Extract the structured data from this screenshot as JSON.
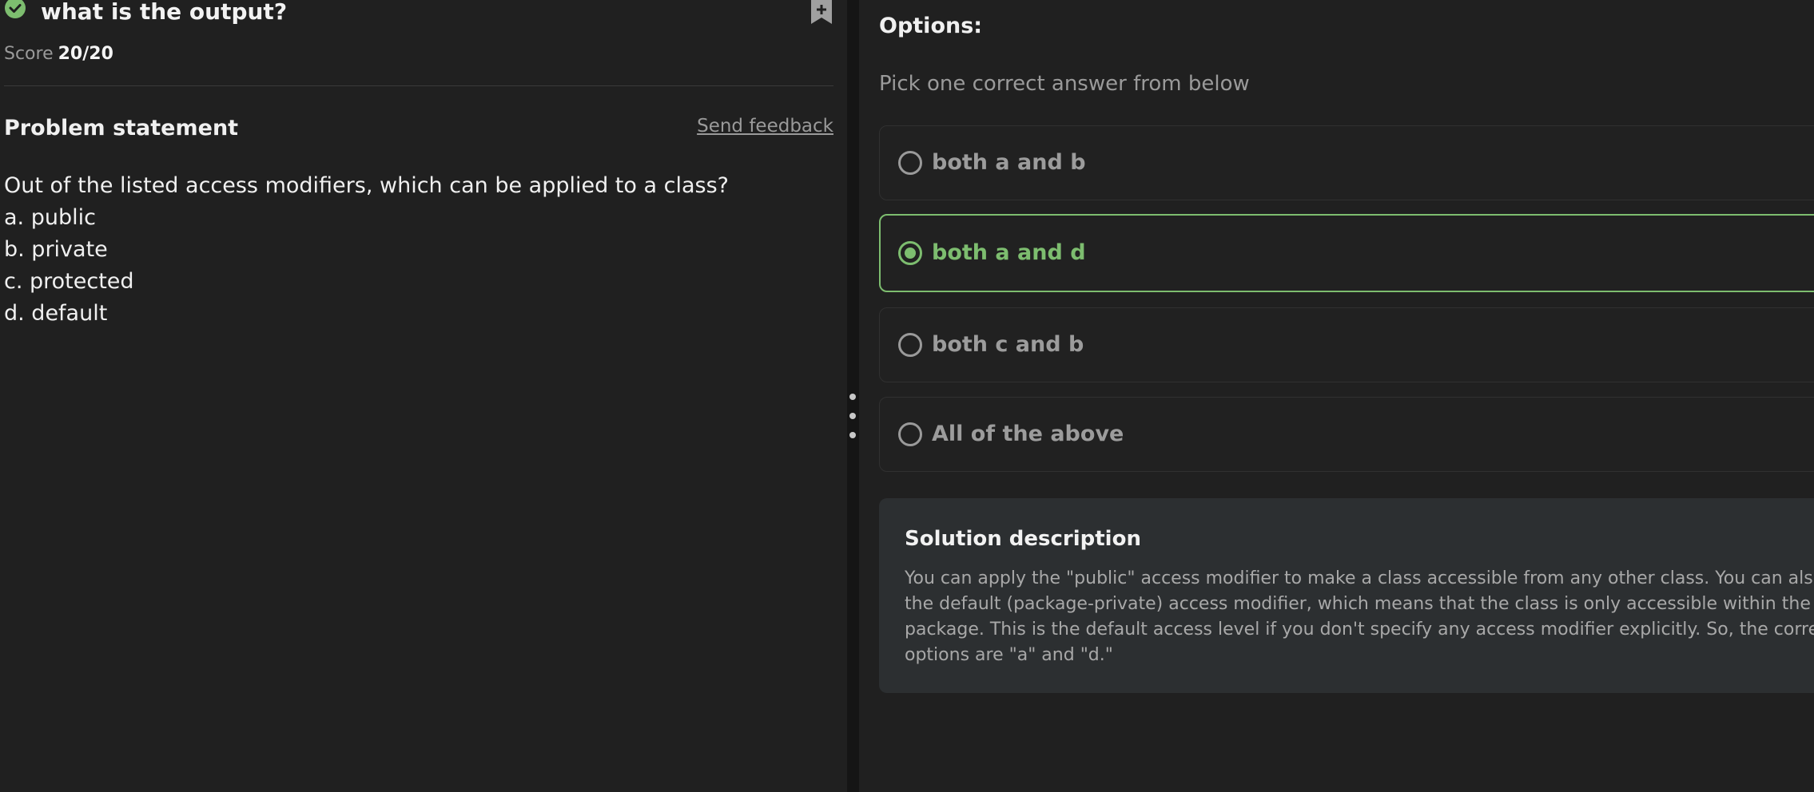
{
  "question": {
    "title": "what is the output?",
    "score_label": "Score",
    "score_value": "20/20",
    "status_icon": "check-circle-icon",
    "bookmark_icon": "bookmark-plus-icon"
  },
  "problem": {
    "heading": "Problem statement",
    "feedback_link": "Send feedback",
    "lines": [
      "Out of the listed access modifiers, which can be applied to a class?",
      "a. public",
      "b. private",
      "c. protected",
      "d. default"
    ]
  },
  "options": {
    "heading": "Options:",
    "subheading": "Pick one correct answer from below",
    "items": [
      {
        "label": "both a and b",
        "selected": false
      },
      {
        "label": "both a and d",
        "selected": true
      },
      {
        "label": "both c and b",
        "selected": false
      },
      {
        "label": "All of the above",
        "selected": false
      }
    ]
  },
  "solution": {
    "heading": "Solution description",
    "lines": [
      "You can apply the \"public\" access modifier to make a class accessible from any other class. You can also use",
      "the default (package-private) access modifier, which means that the class is only accessible within the same",
      "package. This is the default access level if you don't specify any access modifier explicitly. So, the correct",
      "options are \"a\" and \"d.\""
    ]
  },
  "colors": {
    "background": "#202020",
    "accent_green": "#7dbd6f",
    "muted_text": "#9a9a9a",
    "solution_bg": "#2c2f31"
  }
}
